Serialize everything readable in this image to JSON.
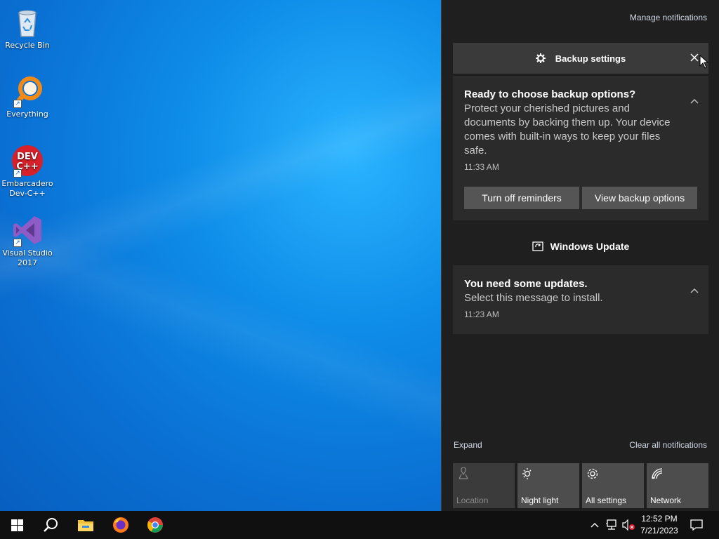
{
  "desktop": {
    "icons": [
      {
        "label": "Recycle Bin"
      },
      {
        "label": "Everything"
      },
      {
        "label": "Embarcadero Dev-C++"
      },
      {
        "label": "Visual Studio 2017"
      }
    ],
    "devcpp_logo_text": "DEV C++"
  },
  "action_center": {
    "manage_label": "Manage notifications",
    "backup_group": {
      "header": "Backup settings",
      "notification": {
        "title": "Ready to choose backup options?",
        "body": "Protect your cherished pictures and documents by backing them up. Your device comes with built-in ways to keep your files safe.",
        "time": "11:33 AM"
      },
      "buttons": [
        "Turn off reminders",
        "View backup options"
      ]
    },
    "update_group": {
      "header": "Windows Update",
      "notification": {
        "title": "You need some updates.",
        "body": "Select this message to install.",
        "time": "11:23 AM"
      }
    },
    "expand_label": "Expand",
    "clear_label": "Clear all notifications",
    "quick_actions": [
      {
        "label": "Location",
        "icon": "location-icon",
        "enabled": false
      },
      {
        "label": "Night light",
        "icon": "night-light-icon",
        "enabled": true
      },
      {
        "label": "All settings",
        "icon": "gear-icon",
        "enabled": true
      },
      {
        "label": "Network",
        "icon": "network-icon",
        "enabled": true
      }
    ]
  },
  "taskbar": {
    "clock_time": "12:52 PM",
    "clock_date": "7/21/2023",
    "pinned": [
      "start-button",
      "search-button",
      "file-explorer",
      "firefox",
      "chrome"
    ]
  },
  "colors": {
    "desktop_blue": "#0a78d7",
    "action_center_bg": "#1f1f1f",
    "card_bg": "#2b2b2b",
    "header_bg": "#3a3a3a",
    "taskbar_bg": "#101010"
  }
}
